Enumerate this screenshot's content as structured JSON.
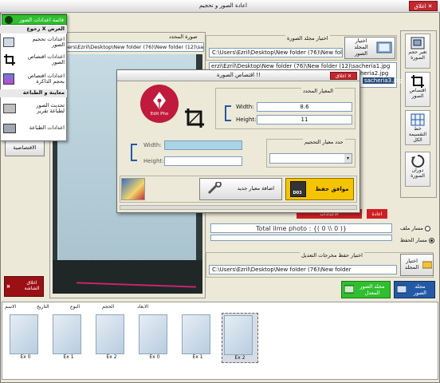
{
  "window": {
    "title": "اعادة الصور و تحجيم",
    "close_label": "اغلاق"
  },
  "toolbar_right": [
    {
      "label": "تغير حجم الصورة",
      "icon": "resize-icon"
    },
    {
      "label": "اقتصاص الصور",
      "icon": "crop-icon"
    },
    {
      "label": "خط التقسيمة الكل",
      "icon": "grid-icon"
    },
    {
      "label": "دوران الصورة",
      "icon": "rotate-icon"
    }
  ],
  "folder": {
    "select_button": "اختيار المجلد الصور",
    "group_label": "اختيار مجلد الصورة",
    "path": "C:\\Users\\Ezril\\Desktop\\New folder (76)\\New folder (12)",
    "files": [
      "erzi\\Ezril\\Desktop\\New folder (76)\\New folder (12)\\sacheria1.jpg",
      "ers\\Ezril\\Desktop\\New folder (76)\\New folder (12)\\sacheria2.jpg",
      "sacheria3.jpg"
    ]
  },
  "preview": {
    "label": "صورة المحدد",
    "path": "C:\\Users\\Ezril\\Desktop\\New folder (76)\\New folder (12)\\sacheria3.jpg"
  },
  "menu": {
    "header": "قائمة اعدادات الصور",
    "items": [
      {
        "label": "رجوع X العرض",
        "type": "head"
      },
      {
        "label": "اعدادات تحجيم الصور",
        "icon": "settings-icon"
      },
      {
        "label": "اعدادات اقتصاص الصور",
        "icon": "crop-icon"
      },
      {
        "label": "اعدادات اقتصاص بحجم الذاكرة",
        "icon": "image-icon"
      },
      {
        "label": "معاينة و الطباعة",
        "type": "head"
      },
      {
        "label": "تحديث الصور لطباعة تقرير",
        "icon": "printer-icon"
      },
      {
        "label": "اعدادات الطباعة",
        "icon": "print-settings-icon"
      }
    ]
  },
  "left_panel": {
    "crop_button": "الاقتصاصية",
    "exit_label": "اغلاق الشاشة"
  },
  "dialog": {
    "title": "اقتصاص الصورة !!",
    "close_label": "اغلاق",
    "edit_caption": "Edit Pho",
    "standard_group": "المعيار المحدد",
    "width_label": "Width:",
    "height_label": "Height:",
    "width_value": "8.6",
    "height_value": "11",
    "custom_width_label": "Width:",
    "custom_height_label": "Height:",
    "custom_width_value": "",
    "custom_height_value": "",
    "size_group": "حدد معيار التحجيم",
    "size_select": "",
    "save_button": "موافق حفظ",
    "save_badge": "D03",
    "add_standard_button": "اضافة معيار جديد"
  },
  "right_info": {
    "red_button": "الاعدادات",
    "red_small": "اعادة",
    "total_text": "Total ilme photo : {( 0 \\\\ 0 )}",
    "radio_all": "مسار الحفظ",
    "radio_one": "مسار ملف"
  },
  "save_path": {
    "group_label": "اختيار حفظ مخرجات التعديل",
    "select_button": "اختيار المجلد",
    "path": "C:\\Users\\Ezril\\Desktop\\New folder (76)\\New folder"
  },
  "bottom_buttons": {
    "open_saved": "مجلد الصور المعدل",
    "open_source": "مجلد الصور"
  },
  "thumbnails": {
    "columns": [
      "الاسم",
      "التاريخ",
      "النوع",
      "الحجم",
      "الابعاد"
    ],
    "items": [
      "Ex 0",
      "Ex 1",
      "Ex 2",
      "Ex 0",
      "Ex 1",
      "Ex 2"
    ]
  },
  "colors": {
    "accent_red": "#d01e24",
    "accent_green": "#2fbf2f",
    "accent_yellow": "#f6c400",
    "accent_blue": "#2459a6"
  }
}
